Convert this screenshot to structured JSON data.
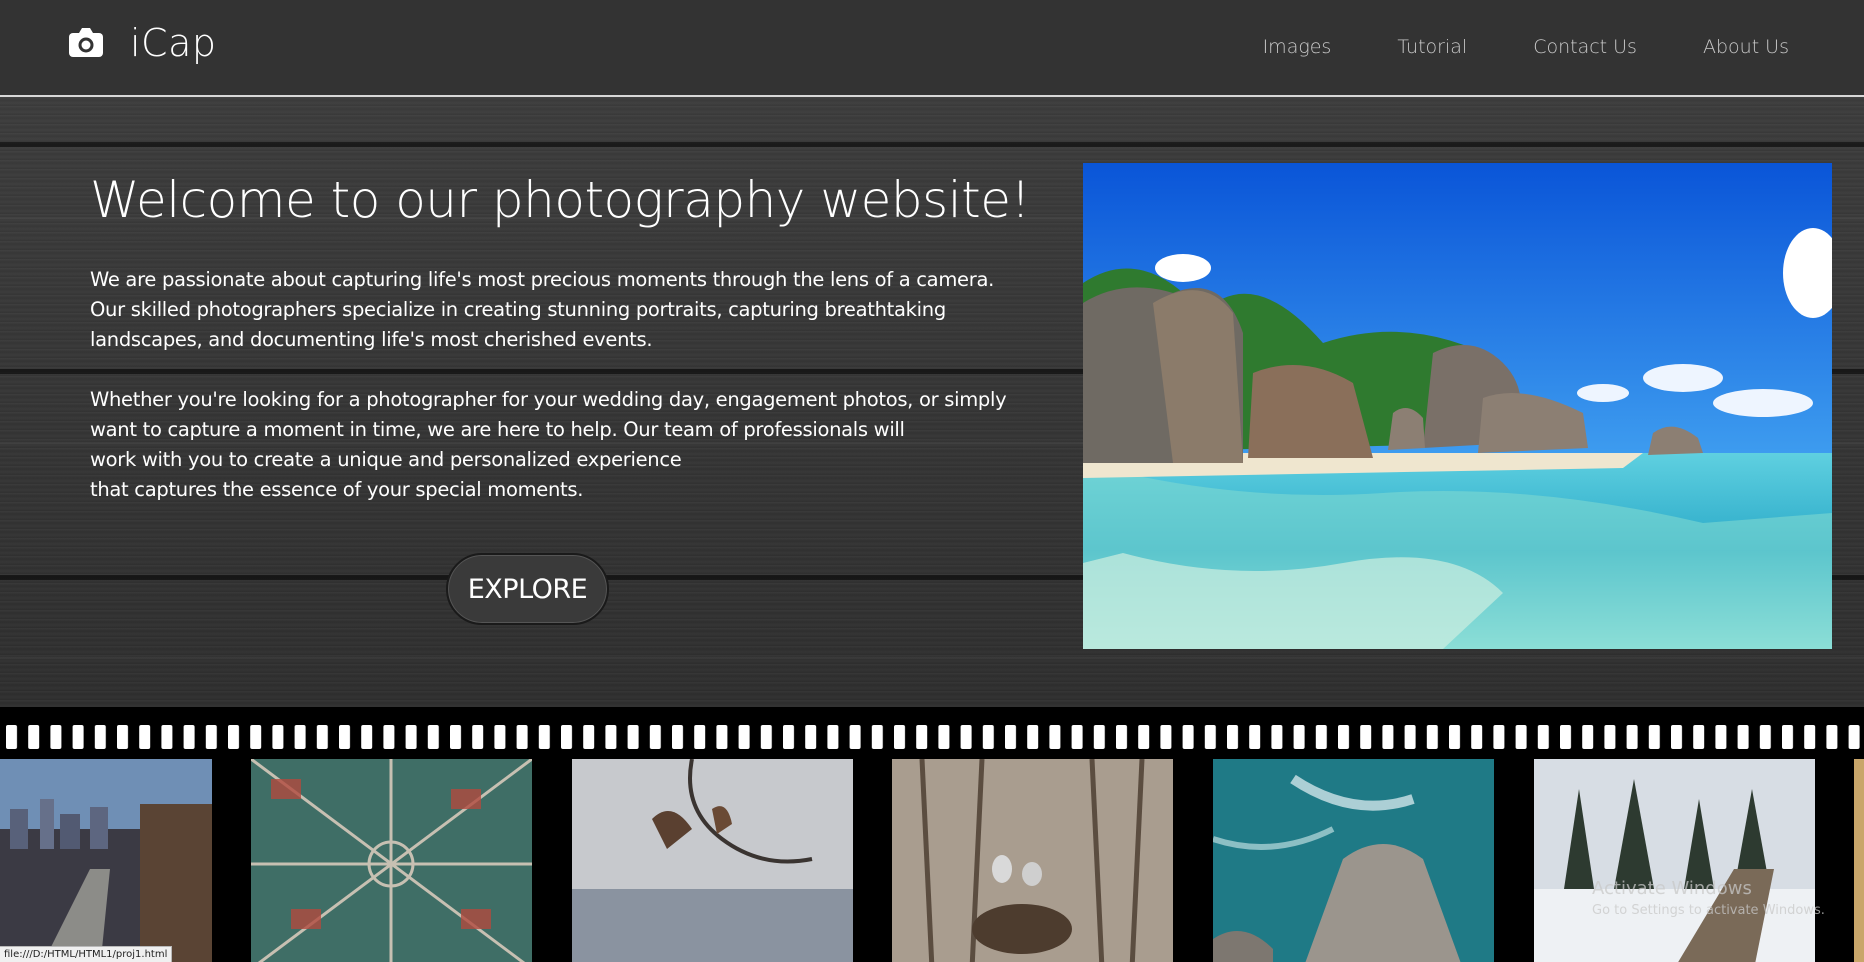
{
  "navbar": {
    "brand": "iCap",
    "brand_icon": "camera-icon",
    "links": [
      "Images",
      "Tutorial",
      "Contact Us",
      "About Us"
    ]
  },
  "hero": {
    "title": "Welcome to our photography website!",
    "paragraph1_lines": [
      "We are passionate about capturing life's most precious moments through the lens of a camera.",
      "Our skilled photographers specialize in creating stunning portraits, capturing breathtaking",
      "landscapes, and documenting life's most cherished events."
    ],
    "paragraph2_lines": [
      "Whether you're looking for a photographer for your wedding day, engagement photos, or simply",
      "want to capture a moment in time, we are here to help. Our team of professionals will",
      "work with you to create a unique and personalized experience",
      "that captures the essence of your special moments."
    ],
    "button": "EXPLORE",
    "image": "tropical-beach-photo"
  },
  "filmstrip": {
    "photos": [
      "city-street-photo",
      "aerial-city-photo",
      "winter-branch-photo",
      "heron-nest-photo",
      "sea-rock-birds-photo",
      "snowy-forest-dock-photo"
    ]
  },
  "watermark": {
    "line1": "Activate Windows",
    "line2": "Go to Settings to activate Windows."
  },
  "status_bar": {
    "url": "file:///D:/HTML/HTML1/proj1.html"
  },
  "colors": {
    "navbar_bg": "#333333",
    "nav_link": "#c9c9c9",
    "text": "#ffffff",
    "film_bg": "#000000"
  }
}
